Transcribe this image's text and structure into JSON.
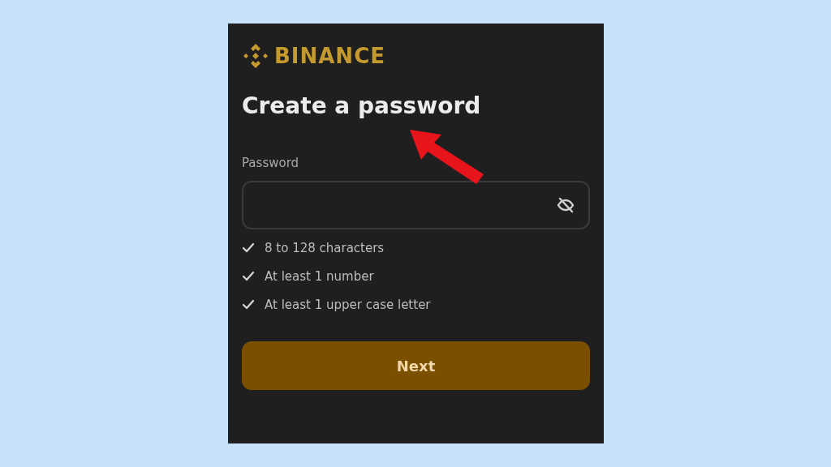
{
  "logo": {
    "wordmark": "BINANCE"
  },
  "heading": "Create a password",
  "password_field": {
    "label": "Password",
    "password_hidden": true
  },
  "requirements": [
    {
      "text": "8 to 128 characters",
      "checked": true
    },
    {
      "text": "At least 1 number",
      "checked": true
    },
    {
      "text": "At least 1 upper case letter",
      "checked": true
    }
  ],
  "buttons": [
    "Next"
  ]
}
